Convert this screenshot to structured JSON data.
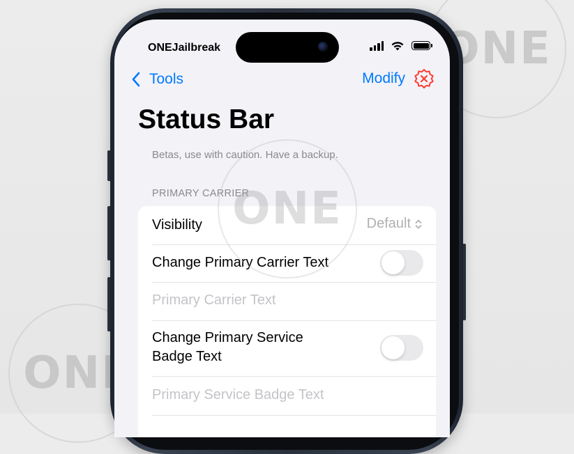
{
  "status_bar": {
    "carrier": "ONEJailbreak",
    "icons": [
      "cellular-signal-icon",
      "wifi-icon",
      "battery-icon"
    ]
  },
  "nav": {
    "back_label": "Tools",
    "modify_label": "Modify",
    "modify_icon": "xmark-badge-icon",
    "accent_color": "#007aff",
    "badge_color": "#ff3b30"
  },
  "page": {
    "title": "Status Bar",
    "subtitle": "Betas, use with caution. Have a backup.",
    "section_header": "PRIMARY CARRIER"
  },
  "rows": {
    "visibility": {
      "label": "Visibility",
      "value": "Default"
    },
    "change_carrier_text": {
      "label": "Change Primary Carrier Text",
      "enabled": false
    },
    "carrier_text_field": {
      "placeholder": "Primary Carrier Text",
      "value": ""
    },
    "change_service_badge": {
      "label_line1": "Change Primary Service",
      "label_line2": "Badge Text",
      "enabled": false
    },
    "service_badge_field": {
      "placeholder": "Primary Service Badge Text",
      "value": ""
    }
  },
  "watermarks": [
    "ONE",
    "ONE",
    "ONE"
  ]
}
